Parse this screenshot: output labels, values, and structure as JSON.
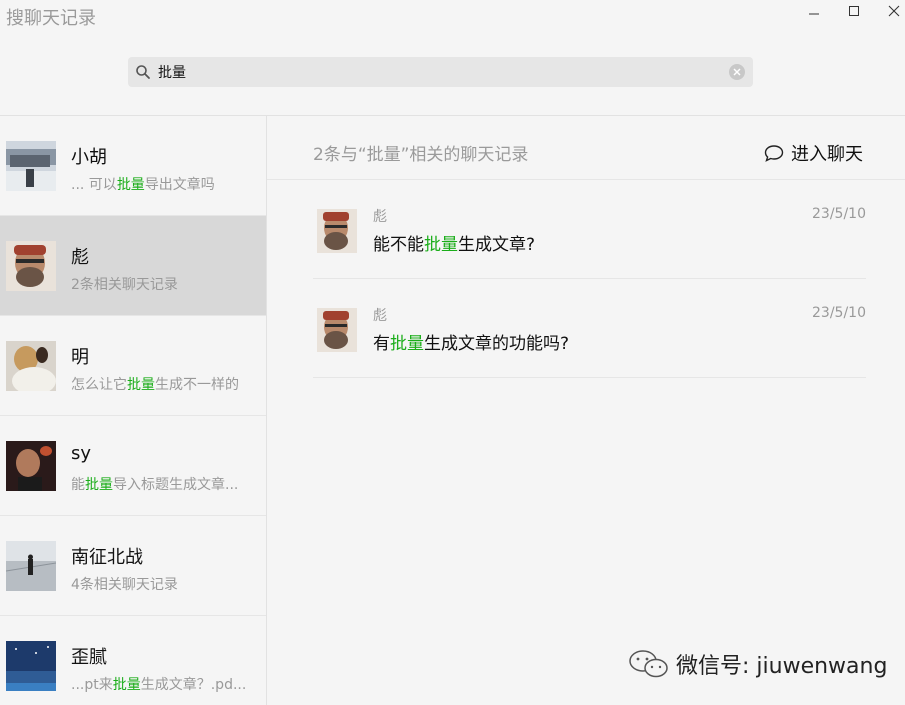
{
  "window": {
    "title": "搜聊天记录",
    "controls": {
      "minimize": "minimize-icon",
      "maximize": "maximize-icon",
      "close": "close-icon"
    }
  },
  "search": {
    "query": "批量",
    "icon": "search-icon",
    "clear_icon": "clear-icon"
  },
  "highlight_color": "#1aad19",
  "contacts": [
    {
      "name": "小胡",
      "snippet": {
        "before": "... 可以",
        "match": "批量",
        "after": "导出文章吗"
      },
      "selected": false
    },
    {
      "name": "彪",
      "snippet": {
        "before": "2条相关聊天记录",
        "match": "",
        "after": ""
      },
      "selected": true
    },
    {
      "name": "明",
      "snippet": {
        "before": "怎么让它",
        "match": "批量",
        "after": "生成不一样的"
      },
      "selected": false
    },
    {
      "name": "sy",
      "snippet": {
        "before": "能",
        "match": "批量",
        "after": "导入标题生成文章..."
      },
      "selected": false
    },
    {
      "name": "南征北战",
      "snippet": {
        "before": "4条相关聊天记录",
        "match": "",
        "after": ""
      },
      "selected": false
    },
    {
      "name": "歪腻",
      "snippet": {
        "before": "...pt来",
        "match": "批量",
        "after": "生成文章？.pd..."
      },
      "selected": false
    }
  ],
  "results": {
    "header": "2条与“批量”相关的聊天记录",
    "enter_chat_label": "进入聊天",
    "enter_chat_icon": "chat-bubble-icon",
    "messages": [
      {
        "sender": "彪",
        "date": "23/5/10",
        "before": "能不能",
        "match": "批量",
        "after": "生成文章?"
      },
      {
        "sender": "彪",
        "date": "23/5/10",
        "before": "有",
        "match": "批量",
        "after": "生成文章的功能吗?"
      }
    ]
  },
  "watermark": {
    "text": "微信号: jiuwenwang",
    "icon": "wechat-logo-icon"
  }
}
